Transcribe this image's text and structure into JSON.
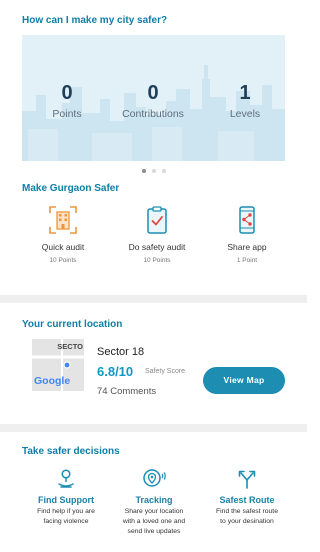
{
  "header": {
    "title": "How can I make my city safer?"
  },
  "stats": [
    {
      "value": "0",
      "label": "Points"
    },
    {
      "value": "0",
      "label": "Contributions"
    },
    {
      "value": "1",
      "label": "Levels"
    }
  ],
  "carousel": {
    "count": 3,
    "active_index": 0
  },
  "safer": {
    "title": "Make Gurgaon Safer",
    "actions": [
      {
        "label": "Quick audit",
        "points": "10 Points",
        "icon": "building-scan-icon"
      },
      {
        "label": "Do safety audit",
        "points": "10 Points",
        "icon": "clipboard-check-icon"
      },
      {
        "label": "Share app",
        "points": "1 Point",
        "icon": "phone-share-icon"
      }
    ]
  },
  "location": {
    "title": "Your current location",
    "map_label": "SECTO",
    "map_brand": "Google",
    "name": "Sector 18",
    "score": "6.8/10",
    "score_label": "Safety Score",
    "comments": "74 Comments",
    "view_map_label": "View Map"
  },
  "decisions": {
    "title": "Take safer decisions",
    "items": [
      {
        "title": "Find Support",
        "desc": [
          "Find help if you are",
          "facing violence"
        ],
        "icon": "person-support-icon"
      },
      {
        "title": "Tracking",
        "desc": [
          "Share your location",
          "with a loved one and",
          "send live updates"
        ],
        "icon": "location-tracking-icon"
      },
      {
        "title": "Safest Route",
        "desc": [
          "Find the safest route",
          "to your desination"
        ],
        "icon": "route-split-icon"
      }
    ]
  },
  "colors": {
    "accent": "#0e7fa6",
    "button": "#1d8db2",
    "score": "#1098c2",
    "card_bg": "#e2f1f8",
    "icon_orange": "#f0953b"
  }
}
